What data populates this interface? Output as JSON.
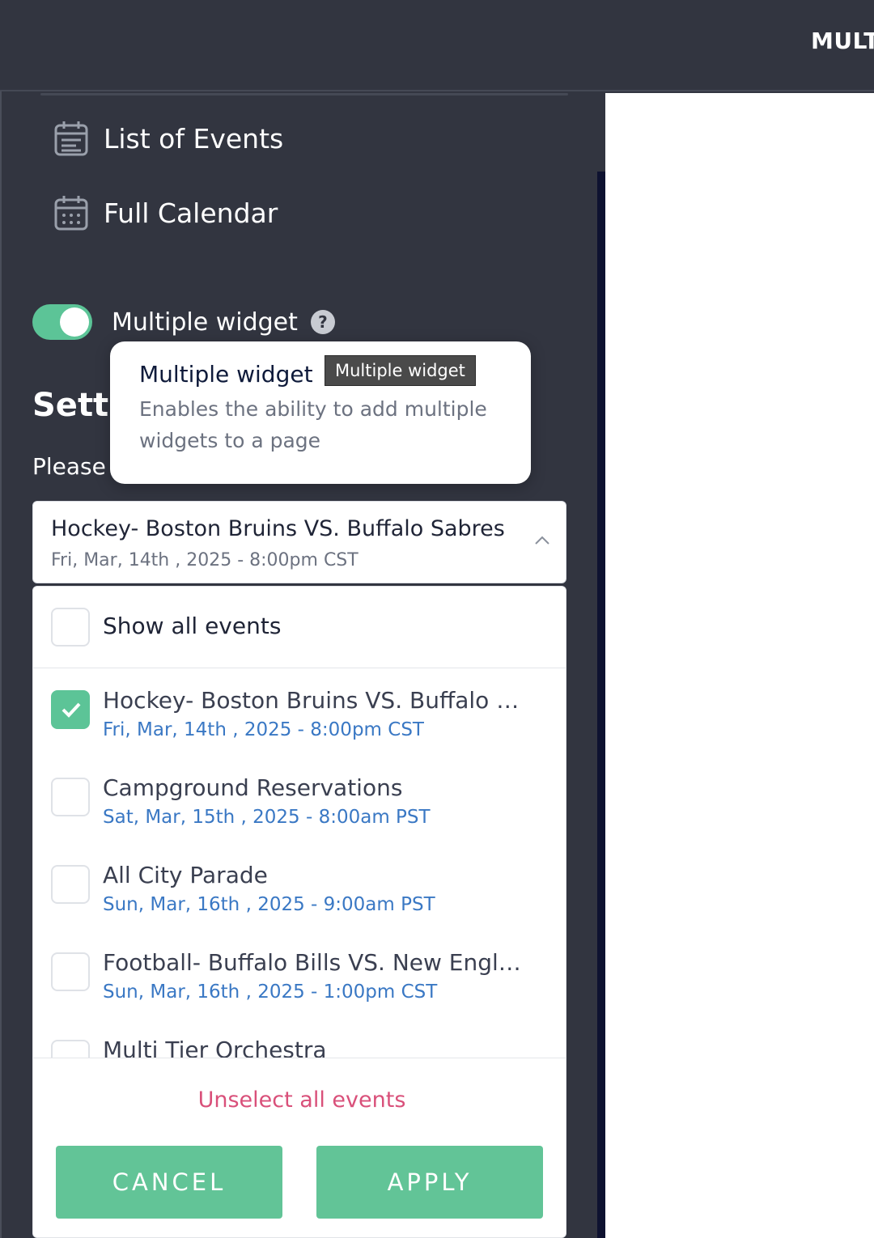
{
  "header": {
    "title": "MULT"
  },
  "sidebar": {
    "nav": [
      {
        "label": "List of Events",
        "icon": "calendar-list-icon"
      },
      {
        "label": "Full Calendar",
        "icon": "calendar-grid-icon"
      }
    ],
    "toggle": {
      "label": "Multiple widget",
      "enabled": true,
      "help_icon": "question-icon"
    },
    "settings_heading": "Setti",
    "please_text": "Please"
  },
  "popover": {
    "title": "Multiple widget",
    "tag": "Multiple widget",
    "body": "Enables the ability to add multiple widgets to a page"
  },
  "event_select": {
    "selected_title": "Hockey- Boston Bruins VS. Buffalo Sabres",
    "selected_date": "Fri, Mar, 14th , 2025 - 8:00pm CST",
    "show_all_label": "Show all events",
    "events": [
      {
        "name": "Hockey- Boston Bruins VS. Buffalo S...",
        "date": "Fri, Mar, 14th , 2025 - 8:00pm CST",
        "checked": true
      },
      {
        "name": "Campground Reservations",
        "date": "Sat, Mar, 15th , 2025 - 8:00am PST",
        "checked": false
      },
      {
        "name": "All City Parade",
        "date": "Sun, Mar, 16th , 2025 - 9:00am PST",
        "checked": false
      },
      {
        "name": "Football- Buffalo Bills VS. New Engla...",
        "date": "Sun, Mar, 16th , 2025 - 1:00pm CST",
        "checked": false
      },
      {
        "name": "Multi Tier Orchestra",
        "date": "",
        "checked": false
      }
    ],
    "unselect_label": "Unselect all events",
    "cancel_label": "CANCEL",
    "apply_label": "APPLY"
  },
  "colors": {
    "accent": "#5cc497",
    "link": "#3a78c4",
    "danger": "#d9507a",
    "background": "#323540"
  }
}
